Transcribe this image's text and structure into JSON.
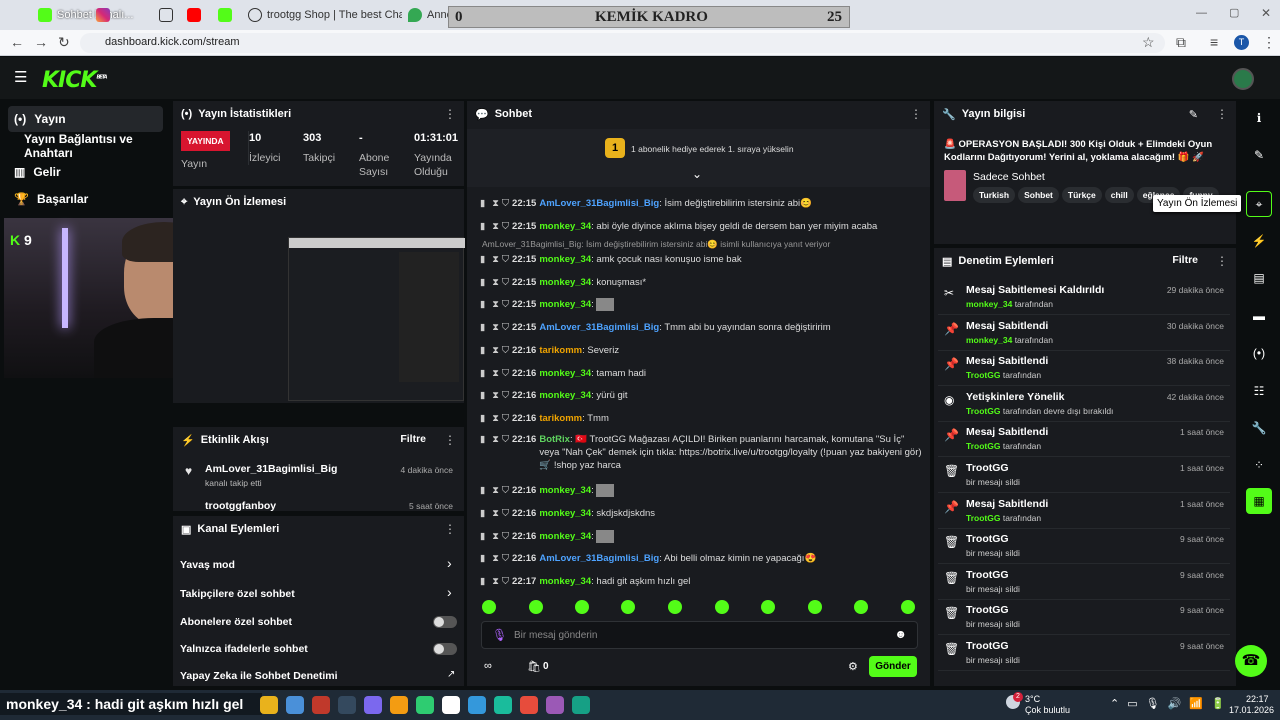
{
  "browser": {
    "tabs": [
      "Sohbet kanalı...",
      "",
      "",
      "",
      "",
      "trootgg Shop | The best ChatB",
      "Annecy Google Haritalar"
    ],
    "url": "dashboard.kick.com/stream",
    "avatar_letter": "T"
  },
  "overlay": {
    "title": "KEMİK KADRO",
    "left_num": "0",
    "right_num": "25"
  },
  "sidebar": {
    "items": [
      {
        "label": "Yayın"
      },
      {
        "label": "Yayın Bağlantısı ve Anahtarı"
      },
      {
        "label": "Gelir"
      },
      {
        "label": "Başarılar"
      }
    ]
  },
  "stats": {
    "title": "Yayın İstatistikleri",
    "live_badge": "YAYINDA",
    "live_label": "Yayın",
    "viewers": "10",
    "viewers_label": "İzleyici",
    "followers": "303",
    "followers_label": "Takipçi",
    "subs": "-",
    "subs_label": "Abone Sayısı",
    "uptime": "01:31:01",
    "uptime_label": "Yayında Olduğu"
  },
  "preview": {
    "title": "Yayın Ön İzlemesi",
    "viewer_count": "9"
  },
  "activity": {
    "title": "Etkinlik Akışı",
    "filter": "Filtre",
    "items": [
      {
        "user": "AmLover_31Bagimlisi_Big",
        "text": "kanalı takip etti",
        "time": "4 dakika önce"
      },
      {
        "user": "trootggfanboy",
        "time": "5 saat önce"
      }
    ]
  },
  "channel_actions": {
    "title": "Kanal Eylemleri",
    "items": [
      "Yavaş mod",
      "Takipçilere özel sohbet",
      "Abonelere özel sohbet",
      "Yalnızca ifadelerle sohbet",
      "Yapay Zeka ile Sohbet Denetimi"
    ]
  },
  "chat": {
    "title": "Sohbet",
    "promo": "1 abonelik hediye ederek 1. sıraya yükselin",
    "promo_num": "1",
    "reply_hint": "AmLover_31Bagimlisi_Big: İsim değiştirebilirim istersiniz abi😊 isimli kullanıcıya yanıt veriyor",
    "messages": [
      {
        "time": "22:15",
        "user": "AmLover_31Bagimlisi_Big",
        "color": "b",
        "text": "İsim değiştirebilirim istersiniz abi😊"
      },
      {
        "time": "22:15",
        "user": "monkey_34",
        "color": "g",
        "text": "abi öyle diyince aklıma bişey geldi de dersem ban yer miyim acaba"
      },
      {
        "time": "22:15",
        "user": "monkey_34",
        "color": "g",
        "text": "amk çocuk nası konuşuo isme bak"
      },
      {
        "time": "22:15",
        "user": "monkey_34",
        "color": "g",
        "text": "konuşması*"
      },
      {
        "time": "22:15",
        "user": "monkey_34",
        "color": "g",
        "text": ""
      },
      {
        "time": "22:15",
        "user": "AmLover_31Bagimlisi_Big",
        "color": "b",
        "text": "Tmm abi bu yayından sonra değiştiririm"
      },
      {
        "time": "22:16",
        "user": "tarikomm",
        "color": "o",
        "text": "Severiz"
      },
      {
        "time": "22:16",
        "user": "monkey_34",
        "color": "g",
        "text": "tamam hadi"
      },
      {
        "time": "22:16",
        "user": "monkey_34",
        "color": "g",
        "text": "yürü git"
      },
      {
        "time": "22:16",
        "user": "tarikomm",
        "color": "o",
        "text": "Tmm"
      },
      {
        "time": "22:16",
        "user": "BotRix",
        "color": "gr",
        "text": "🇹🇷 TrootGG Mağazası AÇILDI! Biriken puanlarını harcamak, komutana \"Su İç\" veya \"Nah Çek\" demek için tıkla: https://botrix.live/u/trootgg/loyalty (!puan yaz bakiyeni gör) 🛒 !shop yaz harca"
      },
      {
        "time": "22:16",
        "user": "monkey_34",
        "color": "g",
        "text": ""
      },
      {
        "time": "22:16",
        "user": "monkey_34",
        "color": "g",
        "text": "skdjskdjskdns"
      },
      {
        "time": "22:16",
        "user": "monkey_34",
        "color": "g",
        "text": ""
      },
      {
        "time": "22:16",
        "user": "AmLover_31Bagimlisi_Big",
        "color": "b",
        "text": "Abi belli olmaz kimin ne yapacağı😍"
      },
      {
        "time": "22:17",
        "user": "monkey_34",
        "color": "g",
        "text": "hadi git aşkım hızlı gel"
      }
    ],
    "input_placeholder": "Bir mesaj gönderin",
    "points": "0",
    "send": "Gönder"
  },
  "stream_info": {
    "title": "Yayın bilgisi",
    "headline": "🚨 OPERASYON BAŞLADI! 300 Kişi Olduk + Elimdeki Oyun Kodlarını Dağıtıyorum! Yerini al, yoklama alacağım! 🎁 🚀",
    "category": "Sadece Sohbet",
    "tags": [
      "Turkish",
      "Sohbet",
      "Türkçe",
      "chill",
      "eğlence",
      "funny"
    ],
    "tooltip": "Yayın Ön İzlemesi"
  },
  "moderation": {
    "title": "Denetim Eylemleri",
    "filter": "Filtre",
    "items": [
      {
        "title": "Mesaj Sabitlemesi Kaldırıldı",
        "who": "monkey_34",
        "suffix": "tarafından",
        "when": "29 dakika önce",
        "icon": "unpin"
      },
      {
        "title": "Mesaj Sabitlendi",
        "who": "monkey_34",
        "suffix": "tarafından",
        "when": "30 dakika önce",
        "icon": "pin"
      },
      {
        "title": "Mesaj Sabitlendi",
        "who": "TrootGG",
        "suffix": "tarafından",
        "when": "38 dakika önce",
        "icon": "pin"
      },
      {
        "title": "Yetişkinlere Yönelik",
        "who": "TrootGG",
        "suffix": "tarafından devre dışı bırakıldı",
        "when": "42 dakika önce",
        "icon": "eye"
      },
      {
        "title": "Mesaj Sabitlendi",
        "who": "TrootGG",
        "suffix": "tarafından",
        "when": "1 saat önce",
        "icon": "pin"
      },
      {
        "title": "TrootGG",
        "who": "",
        "suffix": "bir mesajı sildi",
        "when": "1 saat önce",
        "icon": "trash"
      },
      {
        "title": "Mesaj Sabitlendi",
        "who": "TrootGG",
        "suffix": "tarafından",
        "when": "1 saat önce",
        "icon": "pin"
      },
      {
        "title": "TrootGG",
        "who": "",
        "suffix": "bir mesajı sildi",
        "when": "9 saat önce",
        "icon": "trash"
      },
      {
        "title": "TrootGG",
        "who": "",
        "suffix": "bir mesajı sildi",
        "when": "9 saat önce",
        "icon": "trash"
      },
      {
        "title": "TrootGG",
        "who": "",
        "suffix": "bir mesajı sildi",
        "when": "9 saat önce",
        "icon": "trash"
      },
      {
        "title": "TrootGG",
        "who": "",
        "suffix": "bir mesajı sildi",
        "when": "9 saat önce",
        "icon": "trash"
      }
    ]
  },
  "taskbar": {
    "ticker": "monkey_34 : hadi git aşkım hızlı gel",
    "weather_temp": "3°C",
    "weather_text": "Çok bulutlu",
    "time": "22:17",
    "date": "17.01.2026",
    "notif": "2"
  }
}
